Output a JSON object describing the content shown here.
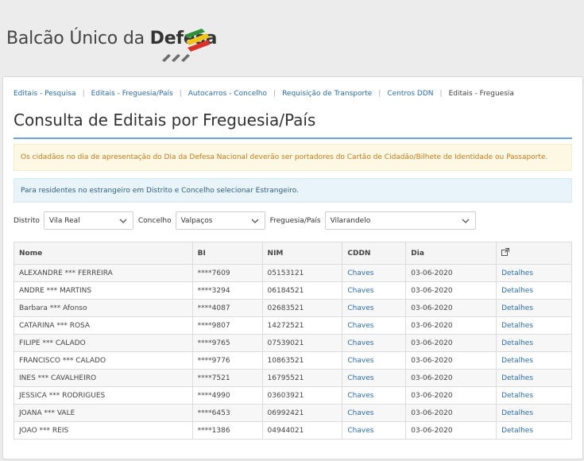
{
  "brand": {
    "prefix": "Balcão Único da ",
    "strong": "Defesa"
  },
  "breadcrumbs": [
    {
      "label": "Editais - Pesquisa"
    },
    {
      "label": "Editais - Freguesia/País"
    },
    {
      "label": "Autocarros - Concelho"
    },
    {
      "label": "Requisição de Transporte"
    },
    {
      "label": "Centros DDN"
    },
    {
      "label": "Editais - Freguesia"
    }
  ],
  "page_title": "Consulta de Editais por Freguesia/País",
  "alerts": {
    "warning": "Os cidadãos no dia de apresentação do Dia da Defesa Nacional deverão ser portadores do Cartão de Cidadão/Bilhete de Identidade ou Passaporte.",
    "info": "Para residentes no estrangeiro em Distrito e Concelho selecionar Estrangeiro."
  },
  "filters": {
    "distrito": {
      "label": "Distrito",
      "value": "Vila Real"
    },
    "concelho": {
      "label": "Concelho",
      "value": "Valpaços"
    },
    "freguesia": {
      "label": "Freguesia/País",
      "value": "Vilarandelo"
    }
  },
  "table": {
    "columns": [
      "Nome",
      "BI",
      "NIM",
      "CDDN",
      "Dia"
    ],
    "external_icon": "external-link-icon",
    "rows": [
      {
        "nome": "ALEXANDRE *** FERREIRA",
        "bi": "****7609",
        "nim": "05153121",
        "cddn": "Chaves",
        "dia": "03-06-2020",
        "link": "Detalhes"
      },
      {
        "nome": "ANDRE *** MARTINS",
        "bi": "****3294",
        "nim": "06184521",
        "cddn": "Chaves",
        "dia": "03-06-2020",
        "link": "Detalhes"
      },
      {
        "nome": "Barbara *** Afonso",
        "bi": "****4087",
        "nim": "02683521",
        "cddn": "Chaves",
        "dia": "03-06-2020",
        "link": "Detalhes"
      },
      {
        "nome": "CATARINA *** ROSA",
        "bi": "****9807",
        "nim": "14272521",
        "cddn": "Chaves",
        "dia": "03-06-2020",
        "link": "Detalhes"
      },
      {
        "nome": "FILIPE *** CALADO",
        "bi": "****9765",
        "nim": "07539021",
        "cddn": "Chaves",
        "dia": "03-06-2020",
        "link": "Detalhes"
      },
      {
        "nome": "FRANCISCO *** CALADO",
        "bi": "****9776",
        "nim": "10863521",
        "cddn": "Chaves",
        "dia": "03-06-2020",
        "link": "Detalhes"
      },
      {
        "nome": "INES *** CAVALHEIRO",
        "bi": "****7521",
        "nim": "16795521",
        "cddn": "Chaves",
        "dia": "03-06-2020",
        "link": "Detalhes"
      },
      {
        "nome": "JESSICA *** RODRIGUES",
        "bi": "****4990",
        "nim": "03603921",
        "cddn": "Chaves",
        "dia": "03-06-2020",
        "link": "Detalhes"
      },
      {
        "nome": "JOANA *** VALE",
        "bi": "****6453",
        "nim": "06992421",
        "cddn": "Chaves",
        "dia": "03-06-2020",
        "link": "Detalhes"
      },
      {
        "nome": "JOAO *** REIS",
        "bi": "****1386",
        "nim": "04944021",
        "cddn": "Chaves",
        "dia": "03-06-2020",
        "link": "Detalhes"
      }
    ]
  }
}
